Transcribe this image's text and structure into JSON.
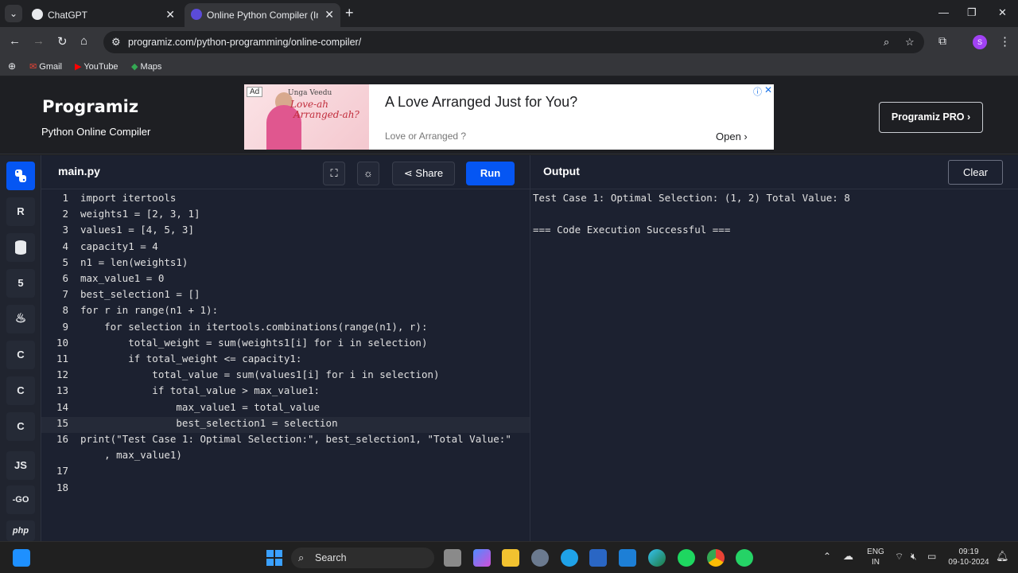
{
  "browser": {
    "tabs": [
      {
        "title": "ChatGPT",
        "active": false
      },
      {
        "title": "Online Python Compiler (Interp",
        "active": true
      }
    ],
    "url": "programiz.com/python-programming/online-compiler/",
    "profile_initial": "S",
    "bookmarks": [
      "Gmail",
      "YouTube",
      "Maps"
    ]
  },
  "site": {
    "logo": "Programiz",
    "subtitle": "Python Online Compiler",
    "pro_button": "Programiz PRO ›"
  },
  "ad": {
    "tag": "Ad",
    "image_line1": "Unga Veedu",
    "image_line2": "Love-ah",
    "image_line3": "Arranged-ah?",
    "headline": "A Love Arranged Just for You?",
    "description": "Love or Arranged ?",
    "cta": "Open ›"
  },
  "sidebar": {
    "languages": [
      {
        "name": "python-icon",
        "label": "",
        "active": true
      },
      {
        "name": "r-icon",
        "label": "R",
        "active": false
      },
      {
        "name": "sql-icon",
        "label": "",
        "active": false
      },
      {
        "name": "html-icon",
        "label": "5",
        "active": false
      },
      {
        "name": "java-icon",
        "label": "",
        "active": false
      },
      {
        "name": "c-icon",
        "label": "C",
        "active": false
      },
      {
        "name": "cpp-icon",
        "label": "C",
        "active": false
      },
      {
        "name": "csharp-icon",
        "label": "C",
        "active": false
      },
      {
        "name": "js-icon",
        "label": "JS",
        "active": false
      },
      {
        "name": "go-icon",
        "label": "-GO",
        "active": false
      },
      {
        "name": "php-icon",
        "label": "php",
        "active": false
      }
    ]
  },
  "editor": {
    "file_name": "main.py",
    "share_label": "Share",
    "run_label": "Run",
    "lines": [
      {
        "n": "1",
        "text": "import itertools"
      },
      {
        "n": "2",
        "text": "weights1 = [2, 3, 1]"
      },
      {
        "n": "3",
        "text": "values1 = [4, 5, 3]"
      },
      {
        "n": "4",
        "text": "capacity1 = 4"
      },
      {
        "n": "5",
        "text": "n1 = len(weights1)"
      },
      {
        "n": "6",
        "text": "max_value1 = 0"
      },
      {
        "n": "7",
        "text": "best_selection1 = []"
      },
      {
        "n": "8",
        "text": "for r in range(n1 + 1):"
      },
      {
        "n": "9",
        "text": "    for selection in itertools.combinations(range(n1), r):"
      },
      {
        "n": "10",
        "text": "        total_weight = sum(weights1[i] for i in selection)"
      },
      {
        "n": "11",
        "text": "        if total_weight <= capacity1:"
      },
      {
        "n": "12",
        "text": "            total_value = sum(values1[i] for i in selection)"
      },
      {
        "n": "13",
        "text": "            if total_value > max_value1:"
      },
      {
        "n": "14",
        "text": "                max_value1 = total_value"
      },
      {
        "n": "15",
        "text": "                best_selection1 = selection"
      },
      {
        "n": "16",
        "text": "print(\"Test Case 1: Optimal Selection:\", best_selection1, \"Total Value:\""
      },
      {
        "n": "",
        "text": "    , max_value1)"
      },
      {
        "n": "17",
        "text": ""
      },
      {
        "n": "18",
        "text": ""
      }
    ]
  },
  "output": {
    "title": "Output",
    "clear_label": "Clear",
    "lines": [
      "Test Case 1: Optimal Selection: (1, 2) Total Value: 8",
      "",
      "=== Code Execution Successful ==="
    ]
  },
  "taskbar": {
    "search_label": "Search",
    "lang_top": "ENG",
    "lang_bottom": "IN",
    "time": "09:19",
    "date": "09-10-2024"
  }
}
